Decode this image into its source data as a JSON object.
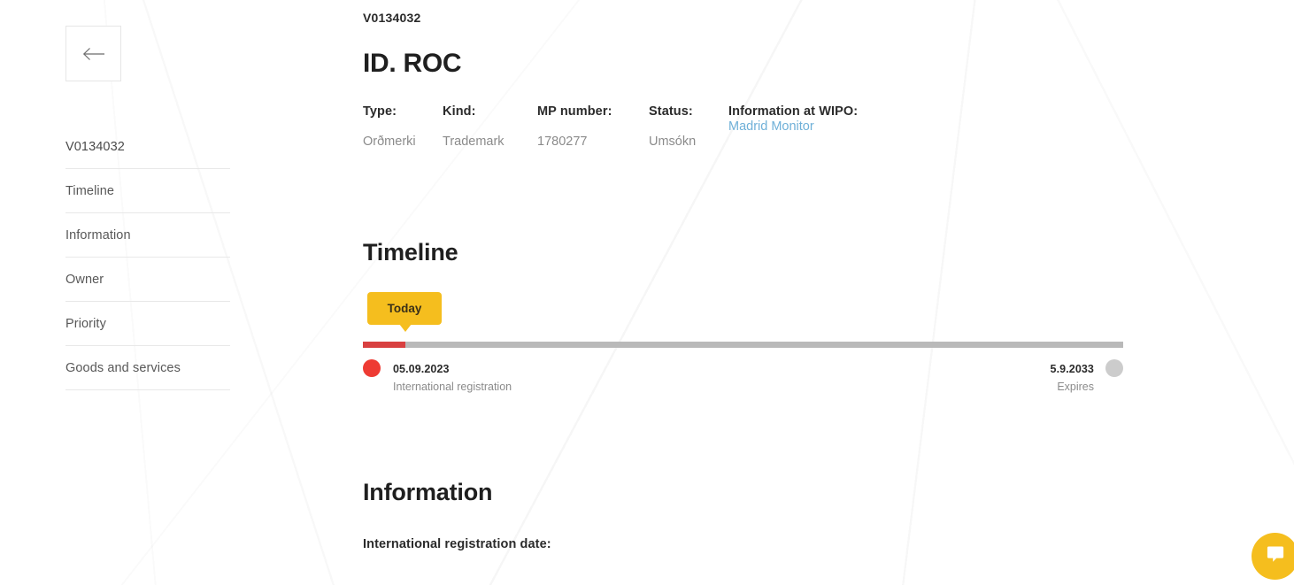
{
  "sidebar": {
    "back_icon": "arrow-left-icon",
    "items": [
      {
        "label": "V0134032"
      },
      {
        "label": "Timeline"
      },
      {
        "label": "Information"
      },
      {
        "label": "Owner"
      },
      {
        "label": "Priority"
      },
      {
        "label": "Goods and services"
      }
    ]
  },
  "header": {
    "record_id": "V0134032",
    "title": "ID. ROC",
    "fields": [
      {
        "label": "Type:",
        "value": "Orðmerki",
        "is_link": false
      },
      {
        "label": "Kind:",
        "value": "Trademark",
        "is_link": false
      },
      {
        "label": "MP number:",
        "value": "1780277",
        "is_link": false
      },
      {
        "label": "Status:",
        "value": "Umsókn",
        "is_link": false
      },
      {
        "label": "Information at WIPO:",
        "value": "Madrid Monitor",
        "is_link": true
      }
    ]
  },
  "timeline": {
    "heading": "Timeline",
    "today_badge": "Today",
    "progress_percent": 5.6,
    "start": {
      "date": "05.09.2023",
      "caption": "International registration"
    },
    "end": {
      "date": "5.9.2033",
      "caption": "Expires"
    }
  },
  "information": {
    "heading": "Information",
    "first_field_label": "International registration date:"
  },
  "chat": {
    "icon": "chat-bubble-icon"
  },
  "colors": {
    "accent_yellow": "#F5BE1E",
    "progress_red": "#D84040",
    "marker_red": "#EE3B33",
    "marker_gray": "#CCCCCC",
    "link_blue": "#6FB0D8",
    "track_gray": "#B9B9B9"
  }
}
